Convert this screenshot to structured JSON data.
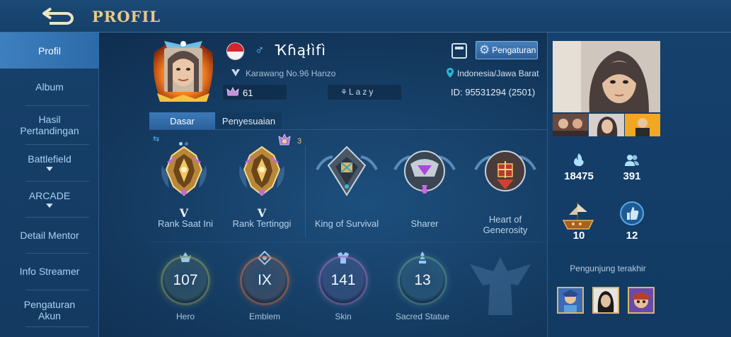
{
  "header": {
    "title": "PROFIL",
    "back_icon": "back-arrow-icon"
  },
  "sidebar": {
    "items": [
      {
        "label": "Profil",
        "active": true
      },
      {
        "label": "Album"
      },
      {
        "label": "Hasil Pertandingan"
      },
      {
        "label": "Battlefield",
        "chevron": "chevron-down-icon"
      },
      {
        "label": "ARCADE",
        "chevron": "chevron-down-icon"
      },
      {
        "label": "Detail Mentor"
      },
      {
        "label": "Info Streamer"
      },
      {
        "label": "Pengaturan Akun"
      }
    ]
  },
  "profile": {
    "name": "Ҡɦąłìfì",
    "gender_symbol": "♂",
    "squad": "Karawang No.96 Hanzo",
    "points": "61",
    "title_badge": "Lazy",
    "location": "Indonesia/Jawa Barat",
    "id_text": "ID: 95531294 (2501)",
    "settings_label": "Pengaturan"
  },
  "tabs": [
    {
      "label": "Dasar",
      "active": true
    },
    {
      "label": "Penyesuaian"
    }
  ],
  "star_count": "3",
  "badges": [
    {
      "numeral": "V",
      "label": "Rank Saat Ini"
    },
    {
      "numeral": "V",
      "label": "Rank Tertinggi"
    },
    {
      "label": "King of Survival"
    },
    {
      "label": "Sharer"
    },
    {
      "label": "Heart of Generosity"
    }
  ],
  "stats": [
    {
      "value": "107",
      "label": "Hero",
      "color": "#8aa36a"
    },
    {
      "value": "IX",
      "label": "Emblem",
      "color": "#c77a5a"
    },
    {
      "value": "141",
      "label": "Skin",
      "color": "#9a7ac7"
    },
    {
      "value": "13",
      "label": "Sacred Statue",
      "color": "#5fa0a0"
    }
  ],
  "right_panel": {
    "popularity": "18475",
    "followers": "391",
    "ship_count": "10",
    "likes": "12",
    "visitors_label": "Pengunjung terakhir"
  },
  "colors": {
    "accent_gold": "#e9c98a",
    "active_blue": "#3e7fbf",
    "label_blue": "#a9d2f2"
  }
}
